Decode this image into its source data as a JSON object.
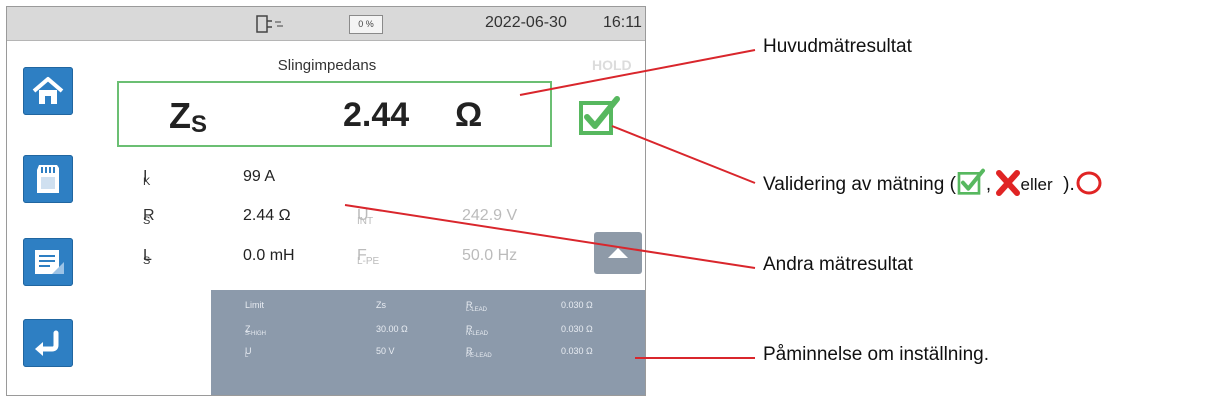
{
  "status_bar": {
    "battery_label": "0 %",
    "date": "2022-06-30",
    "time": "16:11"
  },
  "sidebar": {
    "items": [
      {
        "name": "home",
        "icon": "home-icon"
      },
      {
        "name": "memory",
        "icon": "sd-card-icon"
      },
      {
        "name": "report",
        "icon": "report-icon"
      },
      {
        "name": "back",
        "icon": "return-arrow-icon"
      }
    ]
  },
  "test": {
    "title": "Slingimpedans",
    "hold_label": "HOLD"
  },
  "main_result": {
    "symbol": "Z",
    "subscript": "S",
    "value": "2.44",
    "unit": "Ω"
  },
  "validation_icon": "green-check-icon",
  "measurements": [
    {
      "symbol": "I",
      "sub": "K",
      "value": "99 A",
      "symbol2": "",
      "sub2": "",
      "value2": ""
    },
    {
      "symbol": "R",
      "sub": "S",
      "value": "2.44 Ω",
      "symbol2": "U",
      "sub2": "INT",
      "value2": "242.9 V"
    },
    {
      "symbol": "L",
      "sub": "S",
      "value": "0.0 mH",
      "symbol2": "F",
      "sub2": "L-PE",
      "value2": "50.0 Hz"
    }
  ],
  "settings": [
    {
      "c1": "Limit",
      "c1_sub": "",
      "c2": "Zs",
      "c3": "R",
      "c3_sub": "L-LEAD",
      "c4": "0.030 Ω"
    },
    {
      "c1": "Z",
      "c1_sub": "S-HIGH",
      "c2": "30.00 Ω",
      "c3": "R",
      "c3_sub": "N-LEAD",
      "c4": "0.030 Ω"
    },
    {
      "c1": "U",
      "c1_sub": "L",
      "c2": "50 V",
      "c3": "R",
      "c3_sub": "PE-LEAD",
      "c4": "0.030 Ω"
    }
  ],
  "annotations": {
    "main_result": "Huvudmätresultat",
    "validation_prefix": "Validering av mätning (",
    "validation_comma": ",",
    "validation_or": "eller",
    "validation_suffix": ").",
    "other_results": "Andra mätresultat",
    "settings_reminder": "Påminnelse om inställning."
  },
  "colors": {
    "accent_blue": "#2e7fc3",
    "valid_green": "#6bbf73",
    "callout_red": "#d9262c",
    "settings_panel": "#8c9aab"
  }
}
